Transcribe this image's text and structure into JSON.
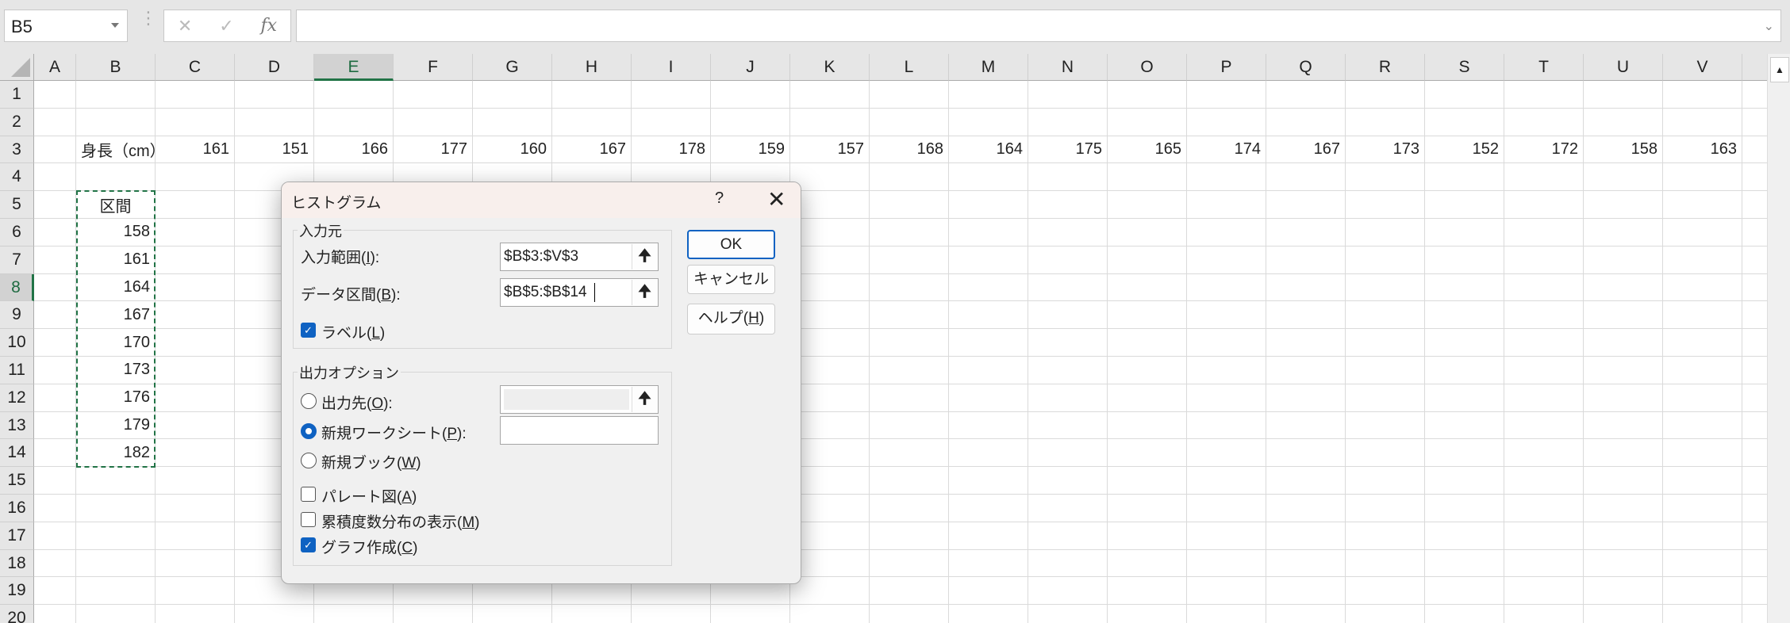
{
  "formula_bar": {
    "name_box": "B5",
    "cancel_icon": "✕",
    "enter_icon": "✓",
    "fx_label": "fx",
    "formula_value": ""
  },
  "sheet": {
    "columns": [
      "A",
      "B",
      "C",
      "D",
      "E",
      "F",
      "G",
      "H",
      "I",
      "J",
      "K",
      "L",
      "M",
      "N",
      "O",
      "P",
      "Q",
      "R",
      "S",
      "T",
      "U",
      "V"
    ],
    "selected_column": "E",
    "rows": [
      "1",
      "2",
      "3",
      "4",
      "5",
      "6",
      "7",
      "8",
      "9",
      "10",
      "11",
      "12",
      "13",
      "14",
      "15",
      "16",
      "17",
      "18",
      "19",
      "20"
    ],
    "selected_row": "8",
    "row3_label": "身長（cm）",
    "heights": [
      "161",
      "151",
      "166",
      "177",
      "160",
      "167",
      "178",
      "159",
      "157",
      "168",
      "164",
      "175",
      "165",
      "174",
      "167",
      "173",
      "152",
      "172",
      "158",
      "163"
    ],
    "bin_header": "区間",
    "bins": [
      "158",
      "161",
      "164",
      "167",
      "170",
      "173",
      "176",
      "179",
      "182"
    ],
    "copy_range": "B5:B14"
  },
  "dialog": {
    "title": "ヒストグラム",
    "help_glyph": "?",
    "close_glyph": "✕",
    "input_group": "入力元",
    "input_range_label": "入力範囲(",
    "input_range_key": "I",
    "input_range_value": "$B$3:$V$3",
    "bin_range_label": "データ区間(",
    "bin_range_key": "B",
    "bin_range_value": "$B$5:$B$14",
    "labels_label": "ラベル(",
    "labels_key": "L",
    "labels_checked": true,
    "output_group": "出力オプション",
    "output_range_label": "出力先(",
    "output_range_key": "O",
    "new_sheet_label": "新規ワークシート(",
    "new_sheet_key": "P",
    "new_sheet_value": "",
    "new_book_label": "新規ブック(",
    "new_book_key": "W",
    "selected_output": "new_sheet",
    "pareto_label": "パレート図(",
    "pareto_key": "A",
    "pareto_checked": false,
    "cumulative_label": "累積度数分布の表示(",
    "cumulative_key": "M",
    "cumulative_checked": false,
    "chart_label": "グラフ作成(",
    "chart_key": "C",
    "chart_checked": true,
    "ok_label": "OK",
    "cancel_label": "キャンセル",
    "help_label": "ヘルプ(",
    "help_key": "H",
    "refedit_icon": "🠉",
    "check_glyph": "✓"
  }
}
